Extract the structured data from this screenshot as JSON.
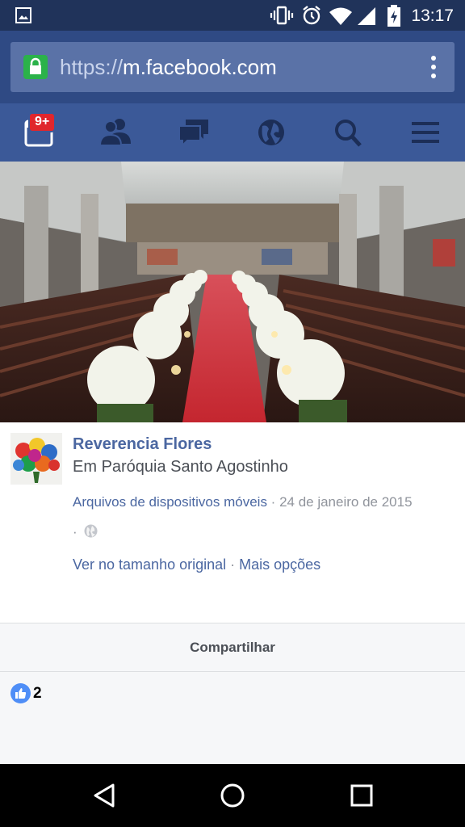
{
  "status_bar": {
    "time": "13:17"
  },
  "browser": {
    "url_protocol": "https://",
    "url_host": "m.facebook.com"
  },
  "fb_nav": {
    "notifications_badge": "9+"
  },
  "post": {
    "author": "Reverencia Flores",
    "location_prefix": "Em ",
    "location": "Paróquia Santo Agostinho",
    "album": "Arquivos de dispositivos móveis",
    "separator": " · ",
    "date": "24 de janeiro de 2015",
    "trailing_dot": "·",
    "view_full": "Ver no tamanho original",
    "more_options": "Mais opções"
  },
  "share": {
    "label": "Compartilhar"
  },
  "reactions": {
    "like_count": "2"
  }
}
